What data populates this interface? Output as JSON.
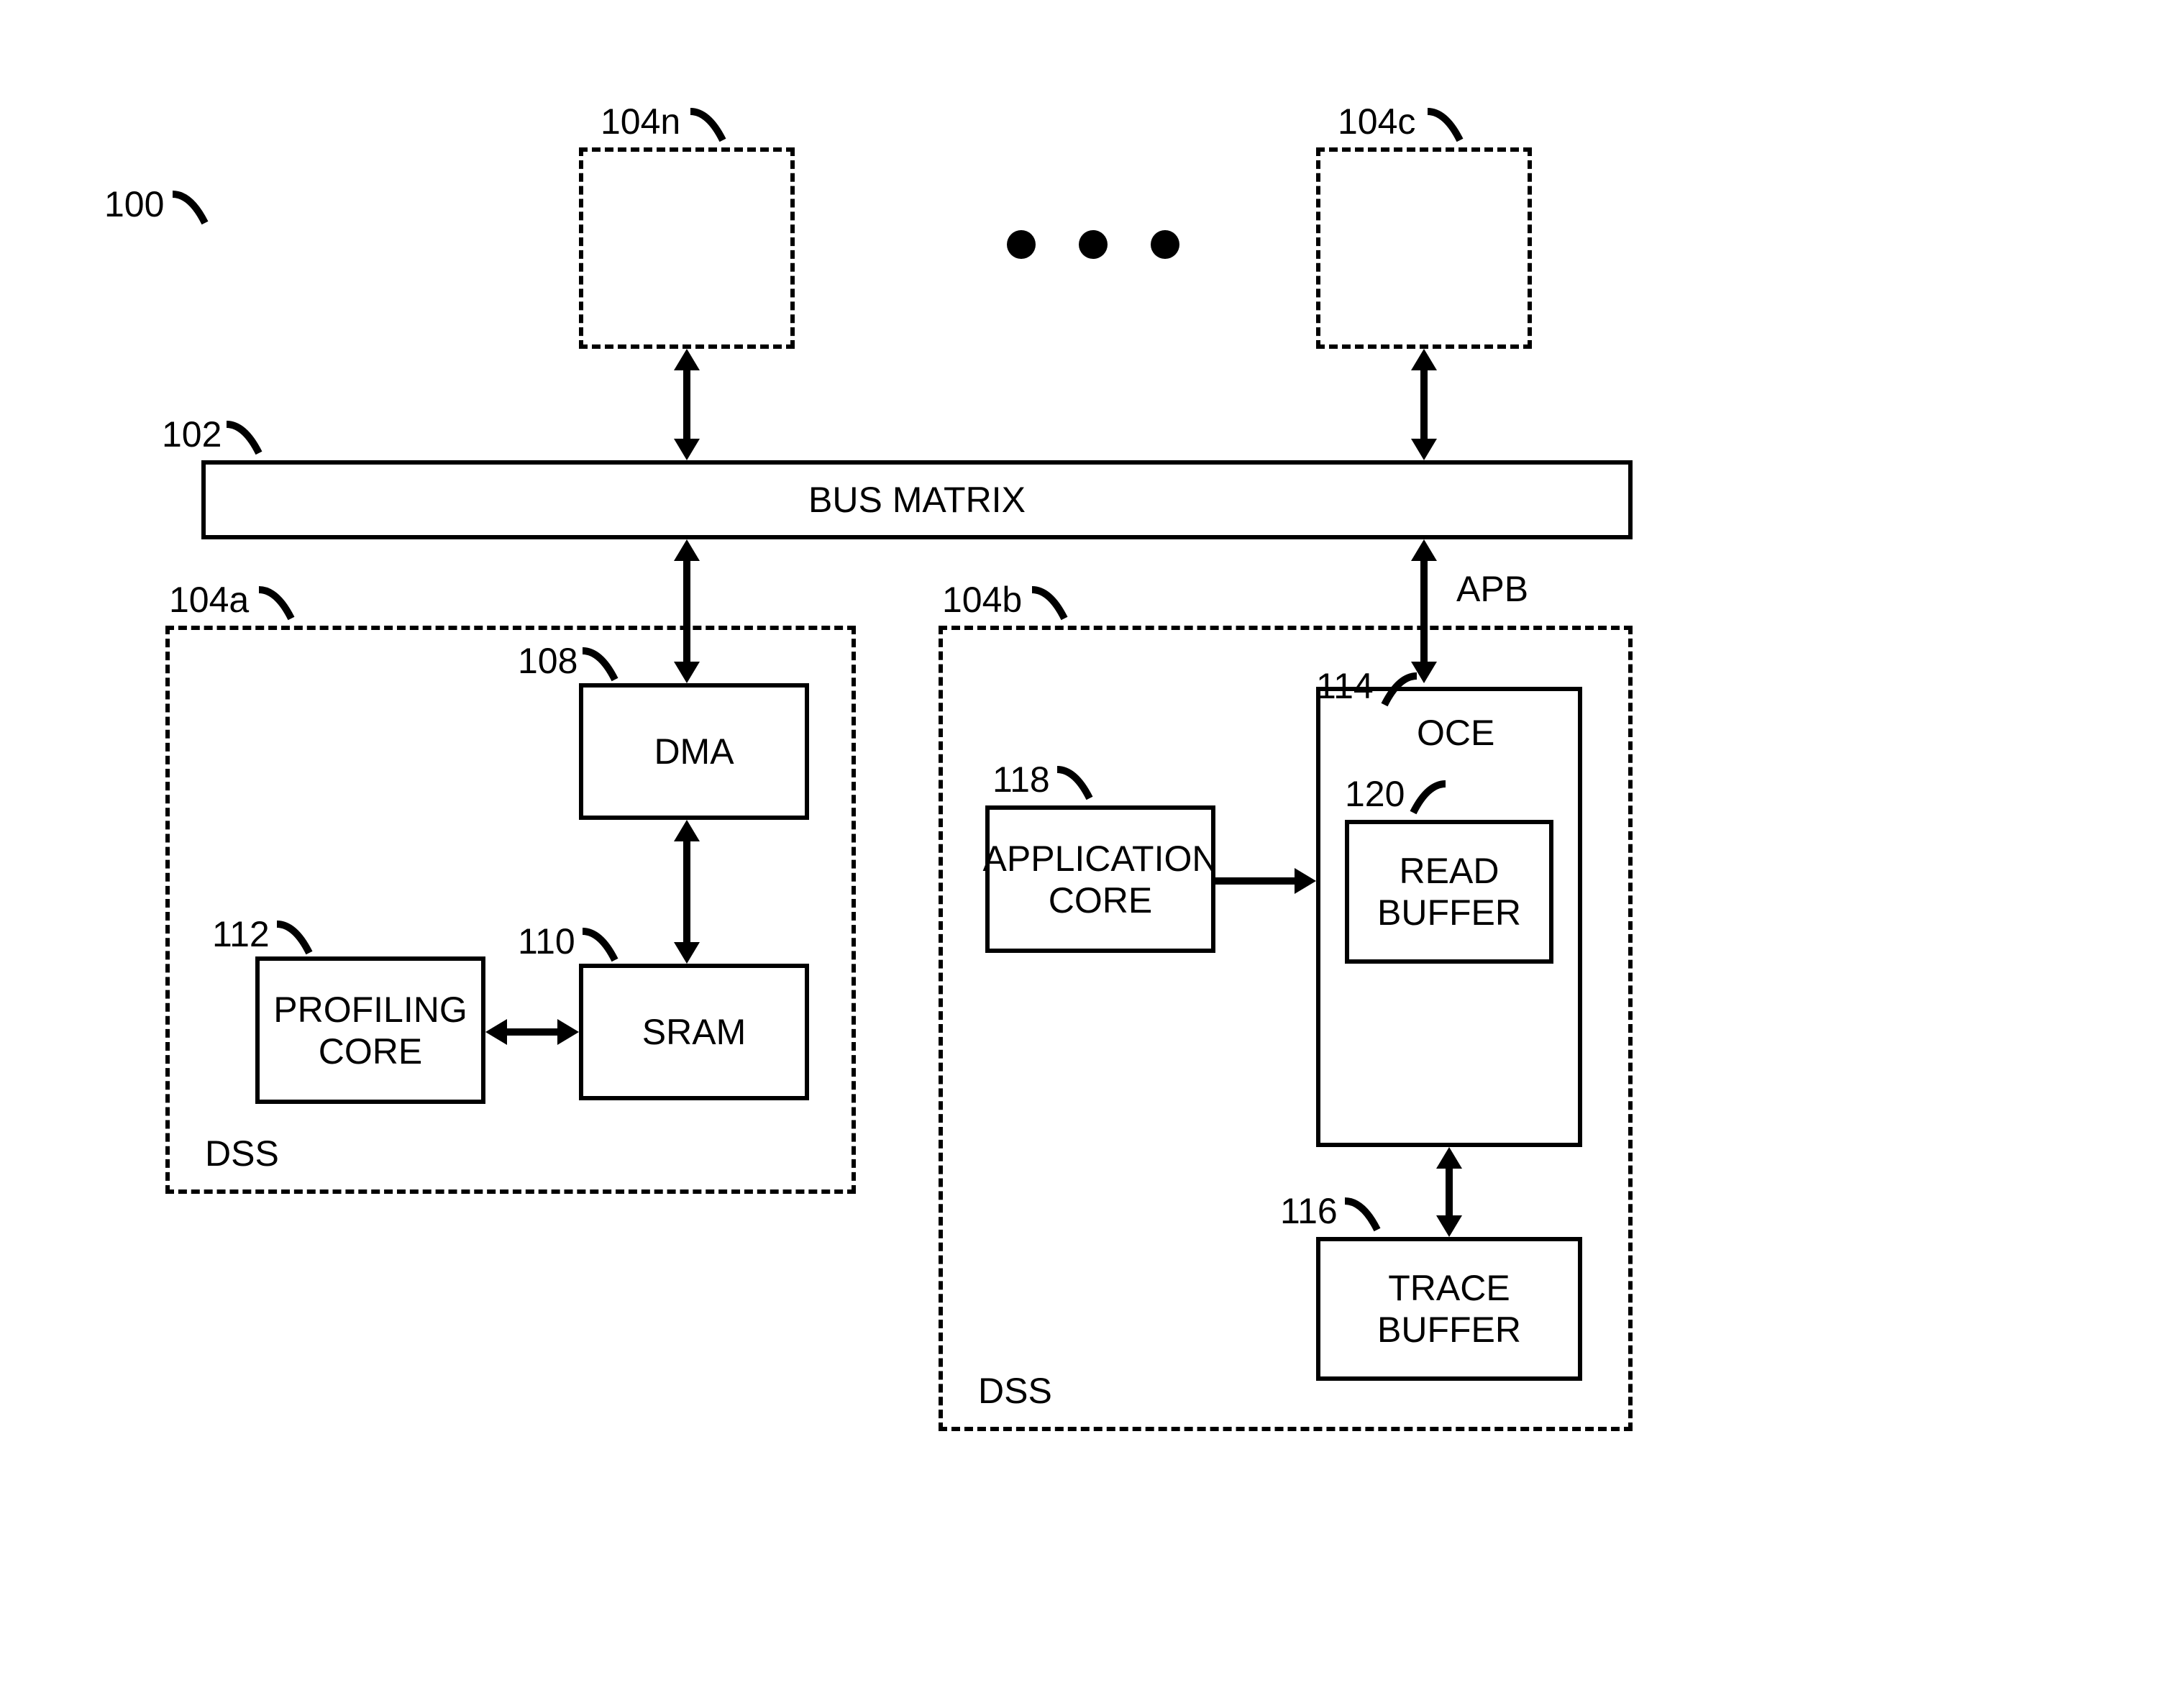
{
  "figure_ref": "100",
  "bus": {
    "ref": "102",
    "label": "BUS MATRIX",
    "connector_label": "APB"
  },
  "top_box_left": {
    "ref": "104n"
  },
  "top_box_right": {
    "ref": "104c"
  },
  "dss_left": {
    "ref": "104a",
    "label": "DSS",
    "dma": {
      "ref": "108",
      "label": "DMA"
    },
    "sram": {
      "ref": "110",
      "label": "SRAM"
    },
    "profiling_core": {
      "ref": "112",
      "label": "PROFILING\nCORE"
    }
  },
  "dss_right": {
    "ref": "104b",
    "label": "DSS",
    "oce": {
      "ref": "114",
      "label": "OCE"
    },
    "trace_buffer": {
      "ref": "116",
      "label": "TRACE\nBUFFER"
    },
    "application_core": {
      "ref": "118",
      "label": "APPLICATION\nCORE"
    },
    "read_buffer": {
      "ref": "120",
      "label": "READ\nBUFFER"
    }
  }
}
